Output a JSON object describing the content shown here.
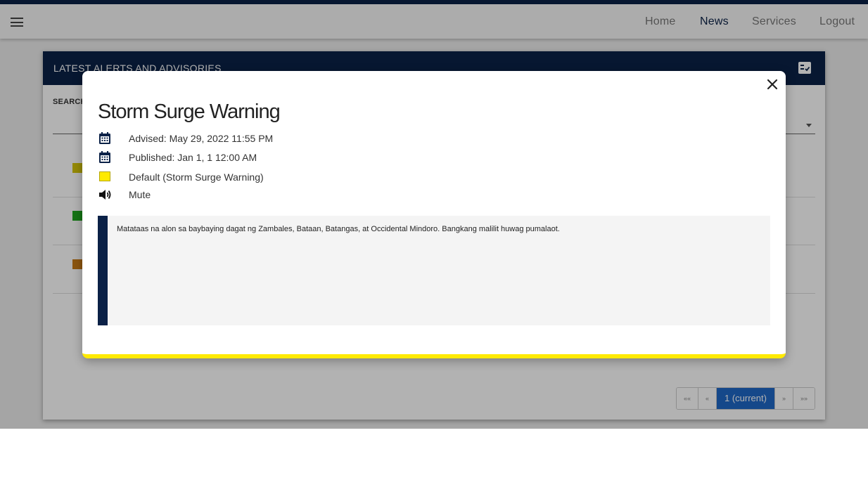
{
  "nav": {
    "links": [
      "Home",
      "News",
      "Services",
      "Logout"
    ],
    "active": "News"
  },
  "card": {
    "title": "Latest Alerts and Advisories",
    "search_label": "SEARCH",
    "row_colors": [
      "#d4c50a",
      "#1ea51e",
      "#c87a16"
    ]
  },
  "pagination": {
    "first": "««",
    "prev": "«",
    "current": "1 (current)",
    "next": "»",
    "last": "»»"
  },
  "modal": {
    "title": "Storm Surge Warning",
    "advised": "Advised: May 29, 2022 11:55 PM",
    "published": "Published: Jan 1, 1 12:00 AM",
    "alert_level": "Default (Storm Surge Warning)",
    "alert_color": "#ffea00",
    "audio": "Mute",
    "message": "Matataas na alon sa baybaying dagat ng Zambales, Bataan, Batangas, at Occidental Mindoro. Bangkang malilit huwag pumalaot."
  },
  "colors": {
    "brand_navy": "#0b2147",
    "pager_active": "#1f67c6"
  }
}
